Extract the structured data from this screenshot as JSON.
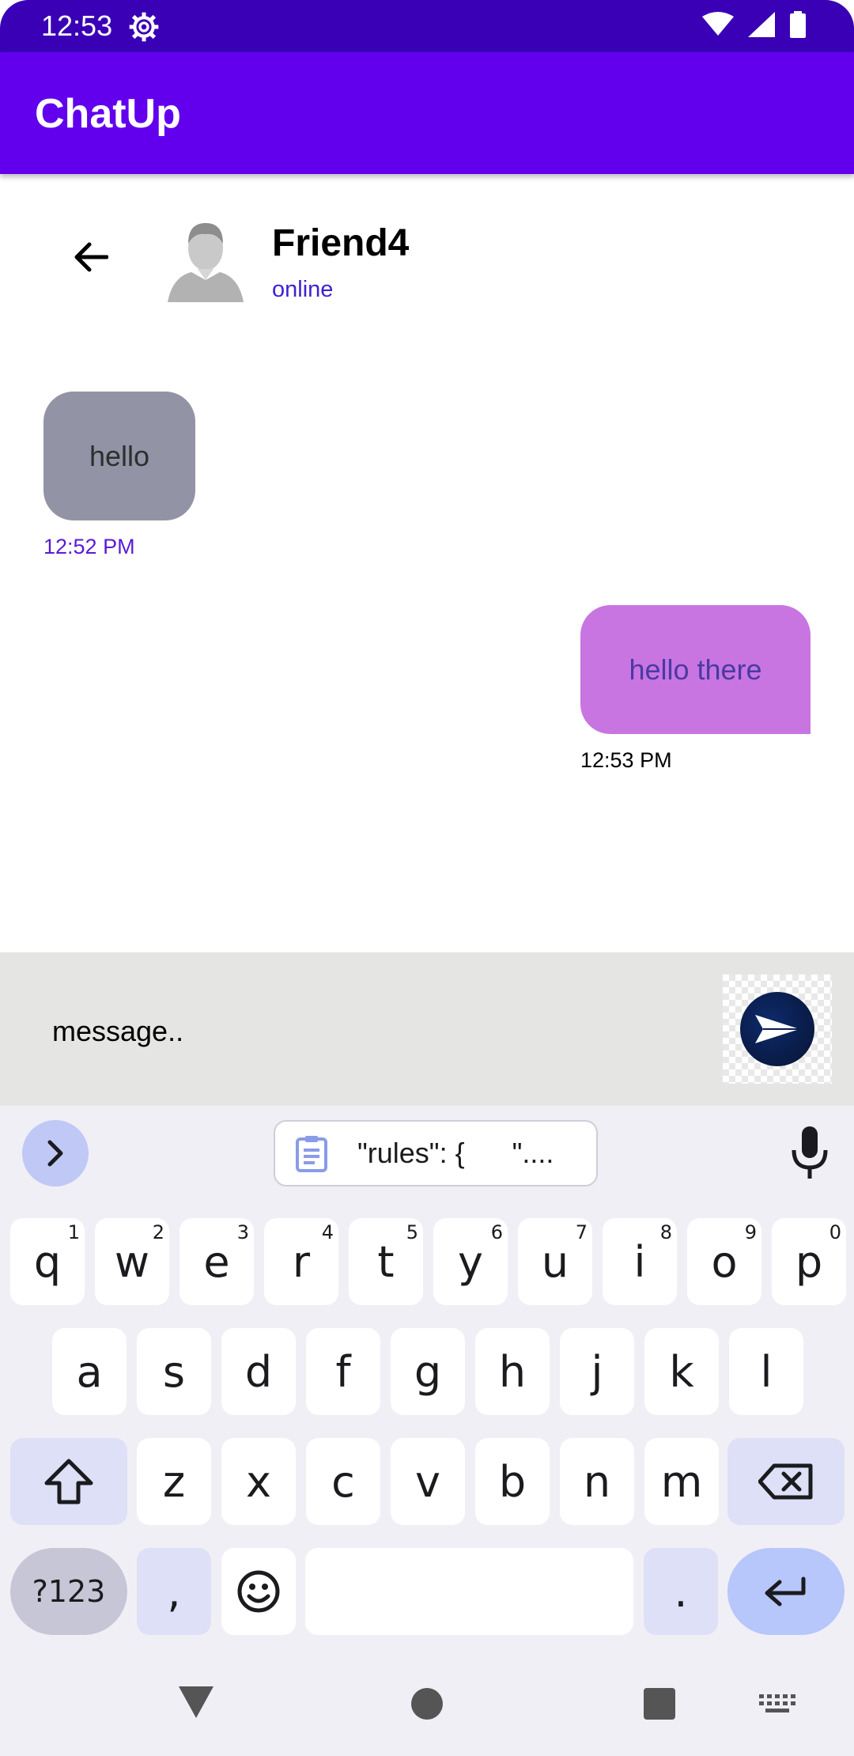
{
  "status_bar": {
    "time": "12:53"
  },
  "app_bar": {
    "title": "ChatUp"
  },
  "chat_header": {
    "name": "Friend4",
    "status": "online"
  },
  "messages": [
    {
      "direction": "incoming",
      "text": "hello",
      "time": "12:52 PM"
    },
    {
      "direction": "outgoing",
      "text": "hello there",
      "time": "12:53 PM"
    }
  ],
  "input": {
    "placeholder": "message.."
  },
  "keyboard": {
    "clipboard_text": "\"rules\": {      \"....",
    "row1": [
      {
        "k": "q",
        "s": "1"
      },
      {
        "k": "w",
        "s": "2"
      },
      {
        "k": "e",
        "s": "3"
      },
      {
        "k": "r",
        "s": "4"
      },
      {
        "k": "t",
        "s": "5"
      },
      {
        "k": "y",
        "s": "6"
      },
      {
        "k": "u",
        "s": "7"
      },
      {
        "k": "i",
        "s": "8"
      },
      {
        "k": "o",
        "s": "9"
      },
      {
        "k": "p",
        "s": "0"
      }
    ],
    "row2": [
      "a",
      "s",
      "d",
      "f",
      "g",
      "h",
      "j",
      "k",
      "l"
    ],
    "row3": [
      "z",
      "x",
      "c",
      "v",
      "b",
      "n",
      "m"
    ],
    "symbols_label": "?123",
    "comma": ",",
    "period": "."
  },
  "colors": {
    "status_bar": "#3a00b5",
    "app_bar": "#6200ee",
    "incoming_bubble": "#9293a5",
    "outgoing_bubble": "#c875e2",
    "input_bar": "#e5e6e4"
  }
}
